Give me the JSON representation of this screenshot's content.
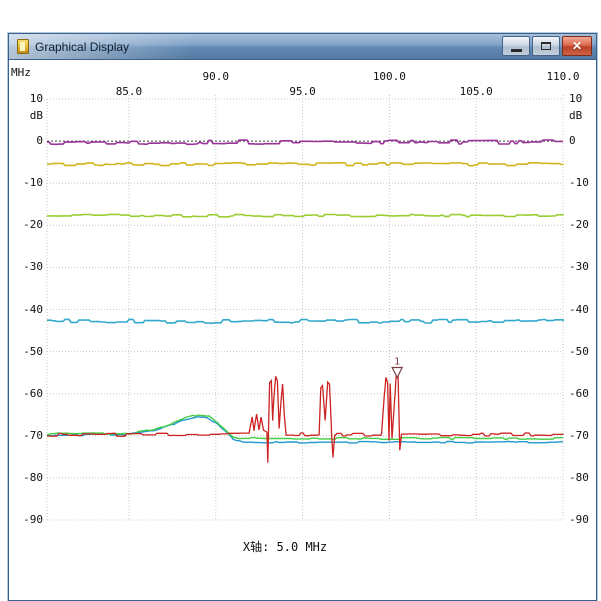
{
  "window": {
    "title": "Graphical Display",
    "controls": {
      "minimize": "minimize",
      "maximize": "maximize",
      "close": "✕"
    }
  },
  "chart_data": {
    "type": "line",
    "footer": "X轴: 5.0 MHz",
    "x_axis": {
      "label": "MHz",
      "min": 80.28,
      "max": 110,
      "ticks": [
        {
          "label": "85.0",
          "value": 85,
          "row": 2
        },
        {
          "label": "90.0",
          "value": 90,
          "row": 1
        },
        {
          "label": "95.0",
          "value": 95,
          "row": 2
        },
        {
          "label": "100.0",
          "value": 100,
          "row": 1
        },
        {
          "label": "105.0",
          "value": 105,
          "row": 2
        },
        {
          "label": "110.0",
          "value": 110,
          "row": 1
        }
      ]
    },
    "y_axis": {
      "label": "dB",
      "min": -90,
      "max": 10,
      "ticks": [
        {
          "label": "10",
          "value": 10
        },
        {
          "label": "0",
          "value": 0
        },
        {
          "label": "-10",
          "value": -10
        },
        {
          "label": "-20",
          "value": -20
        },
        {
          "label": "-30",
          "value": -30
        },
        {
          "label": "-40",
          "value": -40
        },
        {
          "label": "-50",
          "value": -50
        },
        {
          "label": "-60",
          "value": -60
        },
        {
          "label": "-70",
          "value": -70
        },
        {
          "label": "-80",
          "value": -80
        },
        {
          "label": "-90",
          "value": -90
        }
      ]
    },
    "style": {
      "grid_color": "#c8c8c8",
      "zero_line_color": "#404040",
      "background": "#ffffff"
    },
    "marker": {
      "label": "1",
      "mhz": 100.45,
      "db": -55.2,
      "color": "#7a4040"
    },
    "series": [
      {
        "name": "trace-purple",
        "color": "#993399",
        "width": 1.6,
        "noise": 0.5,
        "points": [
          [
            80.28,
            -0.3
          ],
          [
            110,
            -0.2
          ]
        ]
      },
      {
        "name": "trace-gold",
        "color": "#d2b41c",
        "width": 1.6,
        "noise": 0.35,
        "points": [
          [
            80.28,
            -5.5
          ],
          [
            110,
            -5.5
          ]
        ]
      },
      {
        "name": "trace-yellowgreen",
        "color": "#9acd32",
        "width": 1.6,
        "noise": 0.3,
        "points": [
          [
            80.28,
            -17.7
          ],
          [
            110,
            -17.7
          ]
        ]
      },
      {
        "name": "trace-cyan",
        "color": "#33aacc",
        "width": 1.6,
        "noise": 0.45,
        "points": [
          [
            80.28,
            -42.8
          ],
          [
            110,
            -42.8
          ]
        ]
      },
      {
        "name": "trace-blue-bump",
        "color": "#2299cc",
        "width": 1.4,
        "noise": 0.2,
        "points": [
          [
            80.28,
            -69.8
          ],
          [
            84.8,
            -69.7
          ],
          [
            85.5,
            -69.4
          ],
          [
            86.5,
            -68.8
          ],
          [
            87.5,
            -67.4
          ],
          [
            88.3,
            -66.1
          ],
          [
            89.0,
            -65.3
          ],
          [
            89.6,
            -65.8
          ],
          [
            90.1,
            -67.2
          ],
          [
            90.6,
            -69.2
          ],
          [
            91.0,
            -70.8
          ],
          [
            91.5,
            -71.5
          ],
          [
            110,
            -71.5
          ]
        ]
      },
      {
        "name": "trace-green-bump",
        "color": "#44cc44",
        "width": 1.4,
        "noise": 0.25,
        "points": [
          [
            80.28,
            -69.6
          ],
          [
            84.8,
            -69.5
          ],
          [
            85.5,
            -69.2
          ],
          [
            86.5,
            -68.5
          ],
          [
            87.5,
            -67.0
          ],
          [
            88.3,
            -65.7
          ],
          [
            89.0,
            -64.9
          ],
          [
            89.6,
            -65.4
          ],
          [
            90.1,
            -66.8
          ],
          [
            90.6,
            -68.8
          ],
          [
            91.0,
            -70.2
          ],
          [
            91.4,
            -70.6
          ],
          [
            110,
            -70.6
          ]
        ]
      },
      {
        "name": "trace-red",
        "color": "#cc2222",
        "width": 1.3,
        "noise": 0.4,
        "points": [
          [
            80.28,
            -69.7
          ],
          [
            91.9,
            -69.7
          ],
          [
            92.1,
            -65.5
          ],
          [
            92.2,
            -68.8
          ],
          [
            92.35,
            -64.5
          ],
          [
            92.5,
            -68.5
          ],
          [
            92.6,
            -65.8
          ],
          [
            92.75,
            -69.0
          ],
          [
            92.95,
            -69.5
          ],
          [
            93.0,
            -76.0
          ],
          [
            93.1,
            -57.0
          ],
          [
            93.2,
            -56.5
          ],
          [
            93.28,
            -66.0
          ],
          [
            93.35,
            -61.0
          ],
          [
            93.45,
            -56.0
          ],
          [
            93.55,
            -57.0
          ],
          [
            93.65,
            -68.5
          ],
          [
            93.75,
            -62.0
          ],
          [
            93.85,
            -57.5
          ],
          [
            93.95,
            -65.0
          ],
          [
            94.05,
            -69.7
          ],
          [
            95.95,
            -69.7
          ],
          [
            96.05,
            -58.5
          ],
          [
            96.15,
            -58.0
          ],
          [
            96.3,
            -66.5
          ],
          [
            96.45,
            -57.5
          ],
          [
            96.55,
            -58.0
          ],
          [
            96.68,
            -70.0
          ],
          [
            96.75,
            -75.0
          ],
          [
            96.85,
            -69.7
          ],
          [
            99.55,
            -69.7
          ],
          [
            99.7,
            -61.0
          ],
          [
            99.8,
            -55.8
          ],
          [
            99.9,
            -57.0
          ],
          [
            99.98,
            -71.0
          ],
          [
            100.05,
            -58.0
          ],
          [
            100.15,
            -71.0
          ],
          [
            100.3,
            -62.0
          ],
          [
            100.4,
            -55.2
          ],
          [
            100.5,
            -56.0
          ],
          [
            100.6,
            -73.5
          ],
          [
            100.7,
            -69.7
          ],
          [
            110,
            -69.7
          ]
        ]
      }
    ]
  }
}
